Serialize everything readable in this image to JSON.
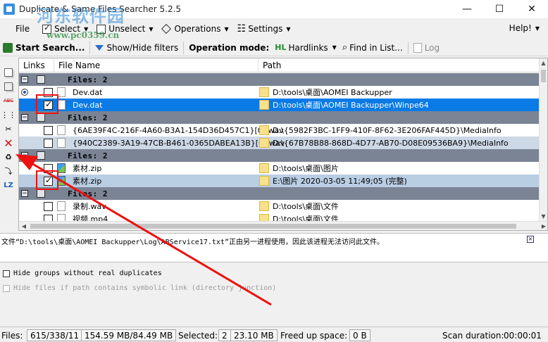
{
  "window": {
    "title": "Duplicate & Same Files Searcher 5.2.5",
    "controls": {
      "minimize": "—",
      "maximize": "☐",
      "close": "✕"
    }
  },
  "watermark": {
    "site": "河东软件园",
    "url": "www.pc0359.cn"
  },
  "menu": {
    "file": "File",
    "select": "Select",
    "unselect": "Unselect",
    "operations": "Operations",
    "settings": "Settings",
    "help": "Help!"
  },
  "toolbar": {
    "start_search": "Start Search...",
    "show_hide_filters": "Show/Hide filters",
    "operation_mode_label": "Operation mode:",
    "operation_mode_value": "Hardlinks",
    "find_in_list": "Find in List...",
    "log": "Log"
  },
  "grid": {
    "columns": [
      "Links",
      "File Name",
      "Path"
    ],
    "group_label": "Files: 2",
    "rows": [
      {
        "kind": "group"
      },
      {
        "kind": "file",
        "radio": true,
        "checked": false,
        "name": "Dev.dat",
        "path": "D:\\tools\\桌面\\AOMEI Backupper",
        "style": "white",
        "icon": "doc"
      },
      {
        "kind": "file",
        "radio": false,
        "checked": true,
        "name": "Dev.dat",
        "path": "D:\\tools\\桌面\\AOMEI Backupper\\Winpe64",
        "style": "sel",
        "icon": "doc"
      },
      {
        "kind": "group"
      },
      {
        "kind": "file",
        "radio": false,
        "checked": false,
        "name": "{6AE39F4C-216F-4A60-B3A1-154D36D457C1}[0].wav",
        "path": "D:\\{5982F3BC-1FF9-410F-8F62-3E206FAF445D}\\MediaInfo",
        "style": "white",
        "icon": "doc"
      },
      {
        "kind": "file",
        "radio": false,
        "checked": false,
        "name": "{940C2389-3A19-47CB-B461-0365DABEA13B}[0].wav",
        "path": "D:\\{67B78B88-868D-4D77-AB70-D08E09536BA9}\\MediaInfo",
        "style": "alt",
        "icon": "doc"
      },
      {
        "kind": "group"
      },
      {
        "kind": "file",
        "radio": false,
        "checked": false,
        "name": "素材.zip",
        "path": "D:\\tools\\桌面\\图片",
        "style": "white",
        "icon": "img"
      },
      {
        "kind": "file",
        "radio": false,
        "checked": true,
        "name": "素材.zip",
        "path": "E:\\图片 2020-03-05 11;49;05 (完整)",
        "style": "alt2",
        "icon": "img"
      },
      {
        "kind": "group"
      },
      {
        "kind": "file",
        "radio": false,
        "checked": false,
        "name": "录制.wav",
        "path": "D:\\tools\\桌面\\文件",
        "style": "white",
        "icon": "doc"
      },
      {
        "kind": "file",
        "radio": false,
        "checked": false,
        "name": "视频.mp4",
        "path": "D:\\tools\\桌面\\文件",
        "style": "white",
        "icon": "doc"
      }
    ]
  },
  "message": "文件“D:\\tools\\桌面\\AOMEI Backupper\\Log\\ABService17.txt”正由另一进程使用，因此该进程无法访问此文件。",
  "options": {
    "hide_groups": "Hide groups without real duplicates",
    "hide_symlinks": "Hide files if path contains symbolic link (directory junction)"
  },
  "status": {
    "files_label": "Files:",
    "files_value": "615/338/11",
    "size_value": "154.59 MB/84.49 MB",
    "selected_label": "Selected:",
    "selected_count": "2",
    "selected_size": "23.10 MB",
    "freed_label": "Freed up space:",
    "freed_value": "0 B",
    "duration_label": "Scan duration:",
    "duration_value": "00:00:01"
  },
  "colors": {
    "group_row": "#7a8494",
    "selected_row": "#0a7ae6",
    "alt_row": "#cdd8e6",
    "annotation_red": "#e11111"
  }
}
